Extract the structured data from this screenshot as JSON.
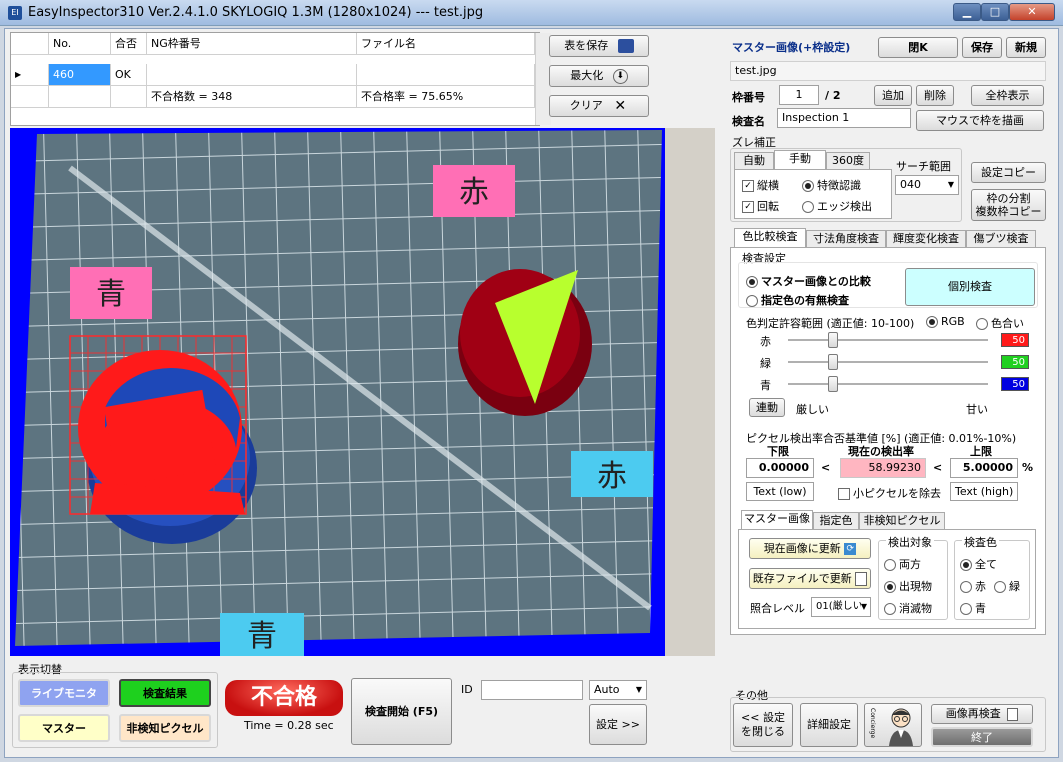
{
  "window": {
    "title": "EasyInspector310 Ver.2.4.1.0 SKYLOGIQ 1.3M  (1280x1024) --- test.jpg",
    "app_icon": "EI",
    "min_label": "▁",
    "max_label": "□",
    "close_label": "✕"
  },
  "grid": {
    "columns": [
      "No.",
      "合否",
      "NG枠番号",
      "ファイル名"
    ],
    "row_marker": "▶",
    "rows": [
      {
        "no": "460",
        "result": "OK",
        "ng": "",
        "file": ""
      },
      {
        "no": "",
        "result": "",
        "ng": "不合格数 = 348",
        "file": "不合格率 = 75.65%"
      }
    ]
  },
  "table_buttons": {
    "save": "表を保存",
    "maximize": "最大化",
    "clear": "クリア"
  },
  "image": {
    "labels": [
      "赤",
      "青",
      "赤",
      "青"
    ]
  },
  "master": {
    "title": "マスター画像(+枠設定)",
    "close": "閉K",
    "save": "保存",
    "new": "新規",
    "filename": "test.jpg",
    "frame_no_label": "枠番号",
    "frame_no_value": "1",
    "frame_total": "/ 2",
    "add": "追加",
    "delete": "削除",
    "show_all": "全枠表示",
    "inspect_name_label": "検査名",
    "inspect_name_value": "Inspection 1",
    "draw_frame": "マウスで枠を描画"
  },
  "offset": {
    "title": "ズレ補正",
    "tabs": [
      "自動",
      "手動",
      "360度"
    ],
    "vertical_horizontal": "縦横",
    "rotation": "回転",
    "feature": "特徴認識",
    "edge": "エッジ検出",
    "search_label": "サーチ範囲",
    "search_value": "040",
    "copy_settings": "設定コピー",
    "split_line1": "枠の分割",
    "split_line2": "複数枠コピー"
  },
  "inspect_tabs": [
    "色比較検査",
    "寸法角度検査",
    "輝度変化検査",
    "傷ブツ検査"
  ],
  "color_inspect": {
    "settings_title": "検査設定",
    "master_compare": "マスター画像との比較",
    "color_presence": "指定色の有無検査",
    "individual": "個別検査",
    "tolerance_label": "色判定許容範囲 (適正値: 10-100)",
    "rgb": "RGB",
    "hue": "色合い",
    "red_label": "赤",
    "green_label": "緑",
    "blue_label": "青",
    "red_value": "50",
    "green_value": "50",
    "blue_value": "50",
    "red_fraction": 0.2,
    "green_fraction": 0.2,
    "blue_fraction": 0.2,
    "link": "連動",
    "strict": "厳しい",
    "loose": "甘い",
    "pixel_title": "ピクセル検出率合否基準値 [%] (適正値: 0.01%-10%)",
    "lower_label": "下限",
    "current_label": "現在の検出率",
    "upper_label": "上限",
    "lower_value": "0.00000",
    "current_value": "58.99230",
    "upper_value": "5.00000",
    "lt1": "<",
    "lt2": "<",
    "pct": "%",
    "text_low": "Text (low)",
    "small_pixel": "小ピクセルを除去",
    "text_high": "Text (high)"
  },
  "sub_tabs": [
    "マスター画像",
    "指定色",
    "非検知ピクセル"
  ],
  "master_image_tab": {
    "update_now": "現在画像に更新",
    "update_file": "既存ファイルで更新",
    "match_level_label": "照合レベル",
    "match_level_value": "01(厳しい",
    "target_title": "検出対象",
    "both": "両方",
    "appear": "出現物",
    "disappear": "消滅物",
    "color_title": "検査色",
    "all": "全て",
    "red": "赤",
    "green": "緑",
    "blue": "青"
  },
  "bottom": {
    "display_title": "表示切替",
    "live": "ライブモニタ",
    "result": "検査結果",
    "master": "マスター",
    "undetected": "非検知ピクセル",
    "status": "不合格",
    "time": "Time = 0.28 sec",
    "start": "検査開始 (F5)",
    "id_label": "ID",
    "id_value": "",
    "mode": "Auto",
    "settings": "設定 >>",
    "other_title": "その他",
    "close_settings_line1": "<< 設定",
    "close_settings_line2": "を閉じる",
    "detail": "詳細設定",
    "concierge": "Concierge",
    "reinspect": "画像再検査",
    "exit": "終了"
  },
  "colors": {
    "accent_blue": "#0a2f8a",
    "fail_red": "#d81c1c",
    "live_bg": "#8fa3f0",
    "result_bg": "#1ed01e",
    "master_bg": "#ffffc8",
    "undetected_bg": "#ffe6c8",
    "individual_bg": "#ccffff"
  }
}
